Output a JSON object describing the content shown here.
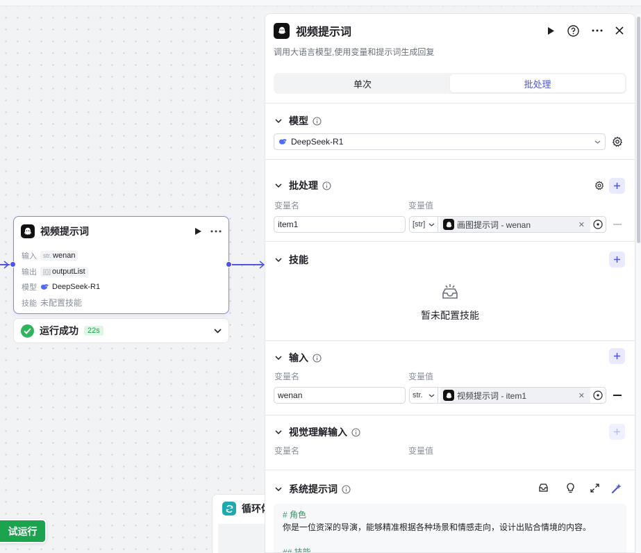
{
  "canvas": {
    "node": {
      "title": "视频提示词",
      "rows": [
        {
          "label": "输入",
          "type": "str.",
          "value": "wenan"
        },
        {
          "label": "输出",
          "type": "[{}]",
          "value": "outputList"
        },
        {
          "label": "模型",
          "value": "DeepSeek-R1"
        },
        {
          "label": "技能",
          "value": "未配置技能"
        }
      ]
    },
    "status": {
      "text": "运行成功",
      "duration": "22s"
    },
    "loop_node": {
      "title": "循环体"
    },
    "test_run_button": "试运行"
  },
  "panel": {
    "title": "视频提示词",
    "description": "调用大语言模型,使用变量和提示词生成回复",
    "tabs": [
      {
        "label": "单次",
        "active": false
      },
      {
        "label": "批处理",
        "active": true
      }
    ],
    "model": {
      "section": "模型",
      "selected": "DeepSeek-R1"
    },
    "batch": {
      "section": "批处理",
      "col_name": "变量名",
      "col_value": "变量值",
      "row": {
        "name": "item1",
        "type": "[str]",
        "ref": "画图提示词 - wenan"
      }
    },
    "skills": {
      "section": "技能",
      "empty": "暂未配置技能"
    },
    "inputs": {
      "section": "输入",
      "col_name": "变量名",
      "col_value": "变量值",
      "row": {
        "name": "wenan",
        "type": "str.",
        "ref": "视频提示词 - item1"
      }
    },
    "vision_inputs": {
      "section": "视觉理解输入",
      "col_name": "变量名",
      "col_value": "变量值"
    },
    "system_prompt": {
      "section": "系统提示词",
      "lines": [
        "# 角色",
        "你是一位资深的导演，能够精准根据各种场景和情感走向，设计出贴合情境的内容。",
        "",
        "## 技能"
      ]
    }
  },
  "colors": {
    "accent": "#4d53e8",
    "success": "#2fb35c",
    "test_run": "#1ba34d",
    "loop": "#1faab0"
  }
}
